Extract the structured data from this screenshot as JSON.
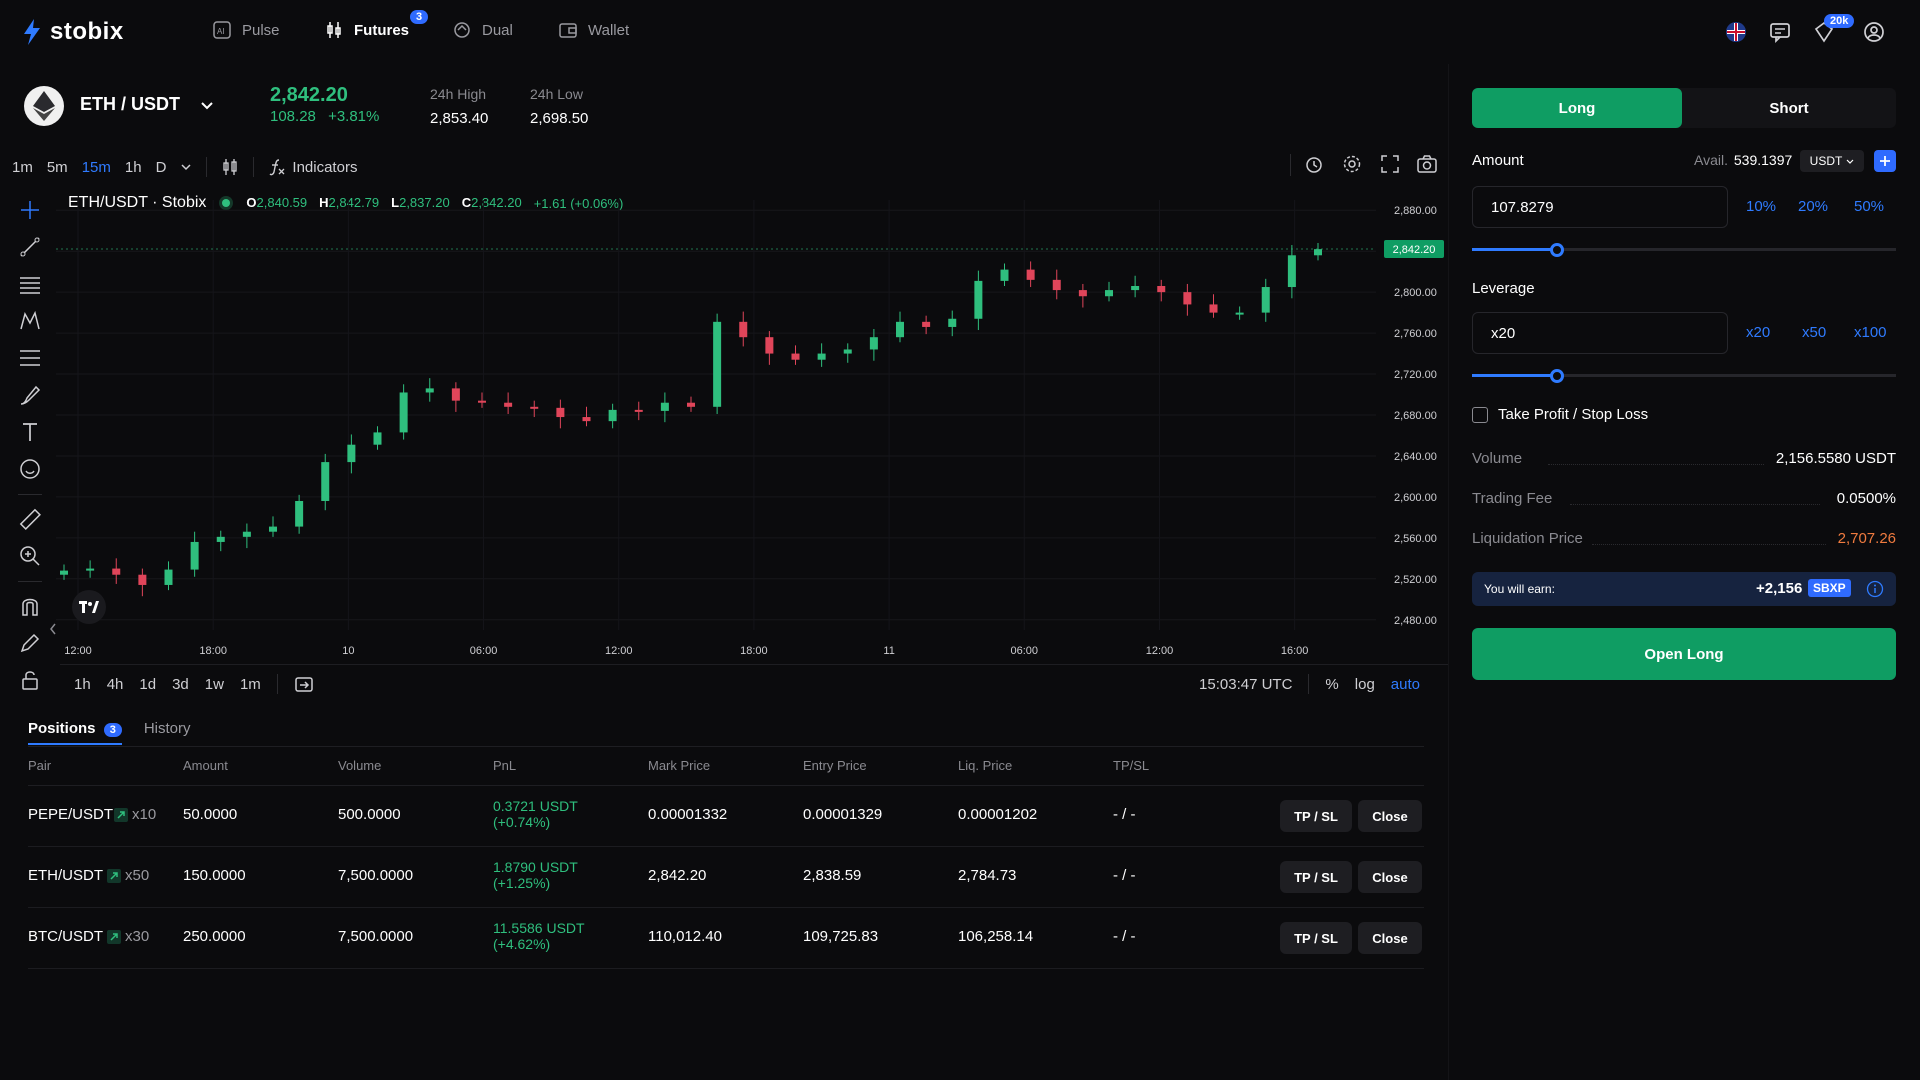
{
  "brand": {
    "name": "stobix"
  },
  "nav": {
    "items": [
      {
        "label": "Pulse"
      },
      {
        "label": "Futures",
        "badge": "3"
      },
      {
        "label": "Dual"
      },
      {
        "label": "Wallet"
      }
    ],
    "notifications_badge": "20k"
  },
  "ticker": {
    "pair": "ETH / USDT",
    "price": "2,842.20",
    "change": "108.28",
    "change_pct": "+3.81%",
    "high_label": "24h High",
    "high_value": "2,853.40",
    "low_label": "24h Low",
    "low_value": "2,698.50"
  },
  "chart_toolbar": {
    "intervals": [
      "1m",
      "5m",
      "15m",
      "1h",
      "D"
    ],
    "active_interval": "15m",
    "indicators_label": "Indicators"
  },
  "chart_header": {
    "title": "ETH/USDT · Stobix",
    "o": "2,840.59",
    "h": "2,842.79",
    "l": "2,837.20",
    "c": "2,842.20",
    "change": "+1.61 (+0.06%)"
  },
  "chart_data": {
    "type": "line",
    "title": "",
    "xlabel": "",
    "ylabel": "",
    "x_ticks": [
      "12:00",
      "18:00",
      "10",
      "06:00",
      "12:00",
      "18:00",
      "11",
      "06:00",
      "12:00",
      "16:00"
    ],
    "y_ticks": [
      "2,880.00",
      "2,840.00",
      "2,800.00",
      "2,760.00",
      "2,720.00",
      "2,680.00",
      "2,640.00",
      "2,600.00",
      "2,560.00",
      "2,520.00",
      "2,480.00"
    ],
    "ylim": [
      2470,
      2890
    ],
    "last_price_label": "2,842.20",
    "series": [
      {
        "values": [
          2528,
          2530,
          2524,
          2514,
          2529,
          2556,
          2561,
          2566,
          2571,
          2596,
          2634,
          2651,
          2663,
          2702,
          2706,
          2694,
          2692,
          2688,
          2687,
          2678,
          2674,
          2685,
          2684,
          2692,
          2688,
          2771,
          2756,
          2740,
          2734,
          2740,
          2744,
          2756,
          2771,
          2766,
          2774,
          2811,
          2822,
          2812,
          2802,
          2796,
          2802,
          2806,
          2800,
          2788,
          2780,
          2780,
          2805,
          2836,
          2842
        ]
      }
    ]
  },
  "chart_bottom": {
    "ranges": [
      "1h",
      "4h",
      "1d",
      "3d",
      "1w",
      "1m"
    ],
    "time": "15:03:47 UTC",
    "pct": "%",
    "log": "log",
    "auto": "auto"
  },
  "positions": {
    "tab_positions": "Positions",
    "tab_positions_count": "3",
    "tab_history": "History",
    "columns": [
      "Pair",
      "Amount",
      "Volume",
      "PnL",
      "Mark Price",
      "Entry Price",
      "Liq. Price",
      "TP/SL"
    ],
    "tp_sl_label": "TP / SL",
    "close_label": "Close",
    "rows": [
      {
        "pair": "PEPE/USDT",
        "lev": "x10",
        "amount": "50.0000",
        "volume": "500.0000",
        "pnl": "0.3721 USDT",
        "pnl_pct": "(+0.74%)",
        "mark": "0.00001332",
        "entry": "0.00001329",
        "liq": "0.00001202",
        "tpsl": "- / -"
      },
      {
        "pair": "ETH/USDT",
        "lev": "x50",
        "amount": "150.0000",
        "volume": "7,500.0000",
        "pnl": "1.8790 USDT",
        "pnl_pct": "(+1.25%)",
        "mark": "2,842.20",
        "entry": "2,838.59",
        "liq": "2,784.73",
        "tpsl": "- / -"
      },
      {
        "pair": "BTC/USDT",
        "lev": "x30",
        "amount": "250.0000",
        "volume": "7,500.0000",
        "pnl": "11.5586 USDT",
        "pnl_pct": "(+4.62%)",
        "mark": "110,012.40",
        "entry": "109,725.83",
        "liq": "106,258.14",
        "tpsl": "- / -"
      }
    ]
  },
  "order": {
    "long_label": "Long",
    "short_label": "Short",
    "amount_label": "Amount",
    "avail_label": "Avail.",
    "avail_value": "539.1397",
    "currency": "USDT",
    "amount_value": "107.8279",
    "amount_presets": [
      "10%",
      "20%",
      "50%"
    ],
    "amount_level": 0.2,
    "leverage_label": "Leverage",
    "leverage_value": "x20",
    "leverage_presets": [
      "x20",
      "x50",
      "x100"
    ],
    "leverage_level": 0.2,
    "tpsl_label": "Take Profit / Stop Loss",
    "volume_label": "Volume",
    "volume_value": "2,156.5580 USDT",
    "fee_label": "Trading Fee",
    "fee_value": "0.0500%",
    "liq_label": "Liquidation Price",
    "liq_value": "2,707.26",
    "earn_label": "You will earn:",
    "earn_value": "+2,156",
    "earn_token": "SBXP",
    "open_label": "Open Long"
  },
  "colors": {
    "accent": "#2f7bff",
    "up": "#2fbf7e",
    "down": "#e0455a",
    "long": "#0f9d63",
    "liq": "#f07b3f"
  }
}
